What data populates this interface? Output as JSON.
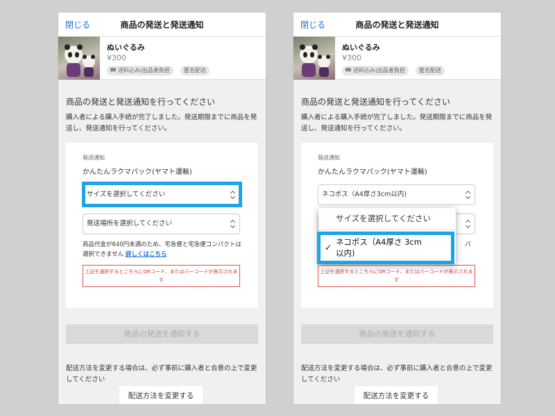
{
  "colors": {
    "background": "#d0d0d0",
    "link": "#1e70d8",
    "highlight": "#1aa5e8",
    "error": "#d33",
    "disabled_button": "#d9d9d9"
  },
  "left": {
    "close": "閉じる",
    "title": "商品の発送と発送通知",
    "product_name": "ぬいぐるみ",
    "price": "¥300",
    "tag_shipping": "送料込み|出品者負担",
    "tag_anon": "匿名配送",
    "section_title": "商品の発送と発送通知を行ってください",
    "description": "購入者による購入手続が完了しました。発送期限までに商品を発送し、発送通知を行ってください。",
    "card_label": "発送通知",
    "carrier": "かんたんラクマパック(ヤマト運輸)",
    "size_select": "サイズを選択してください",
    "place_select": "発送場所を選択してください",
    "note": "商品代金が640円未満のため、宅急便と宅急便コンパクトは選択できません",
    "note_link": "詳しくはこちら",
    "qr_notice": "上記を選択するとこちらにQRコード、またはバーコードが表示されます",
    "notify_button": "商品の発送を通知する",
    "footer": "配送方法を変更する場合は、必ず事前に購入者と合意の上で変更してください",
    "change_button": "配送方法を変更する"
  },
  "right": {
    "close": "閉じる",
    "title": "商品の発送と発送通知",
    "product_name": "ぬいぐるみ",
    "price": "¥300",
    "tag_shipping": "送料込み|出品者負担",
    "tag_anon": "匿名配送",
    "section_title": "商品の発送と発送通知を行ってください",
    "description": "購入者による購入手続が完了しました。発送期限までに商品を発送し、発送通知を行ってください。",
    "card_label": "発送通知",
    "carrier": "かんたんラクマパック(ヤマト運輸)",
    "size_select": "ネコポス（A4厚さ3cm以内)",
    "note_tail": "パ",
    "qr_notice": "上記を選択するとこちらにQRコード、またはバーコードが表示されます",
    "notify_button": "商品の発送を通知する",
    "footer": "配送方法を変更する場合は、必ず事前に購入者と合意の上で変更してください",
    "change_button": "配送方法を変更する"
  },
  "dropdown": {
    "option_placeholder": "サイズを選択してください",
    "option_selected": "ネコポス（A4厚さ 3cm 以内)",
    "check": "✓"
  }
}
